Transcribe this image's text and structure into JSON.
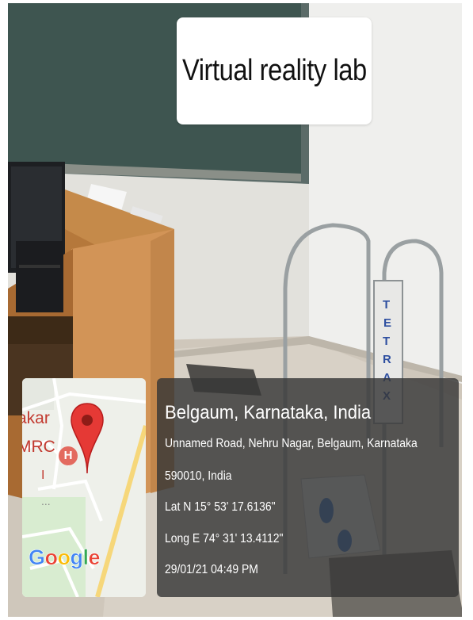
{
  "overlay_title": "Virtual reality lab",
  "device_label": [
    "T",
    "E",
    "T",
    "R",
    "A",
    "X"
  ],
  "map": {
    "labels": [
      "akar",
      "MRC",
      "I",
      "..."
    ],
    "hospital_marker": "H",
    "logo_letters": [
      {
        "char": "G",
        "color": "#4285F4"
      },
      {
        "char": "o",
        "color": "#EA4335"
      },
      {
        "char": "o",
        "color": "#FBBC05"
      },
      {
        "char": "g",
        "color": "#4285F4"
      },
      {
        "char": "l",
        "color": "#34A853"
      },
      {
        "char": "e",
        "color": "#EA4335"
      }
    ],
    "pin_icon": "map-pin-icon",
    "pin_color": "#E53935"
  },
  "location": {
    "title": "Belgaum, Karnataka, India",
    "address_line1": "Unnamed Road, Nehru Nagar, Belgaum, Karnataka",
    "address_line2": "590010, India",
    "latitude": "Lat N 15° 53' 17.6136\"",
    "longitude": "Long E 74° 31' 13.4112\"",
    "timestamp": "29/01/21 04:49 PM"
  }
}
